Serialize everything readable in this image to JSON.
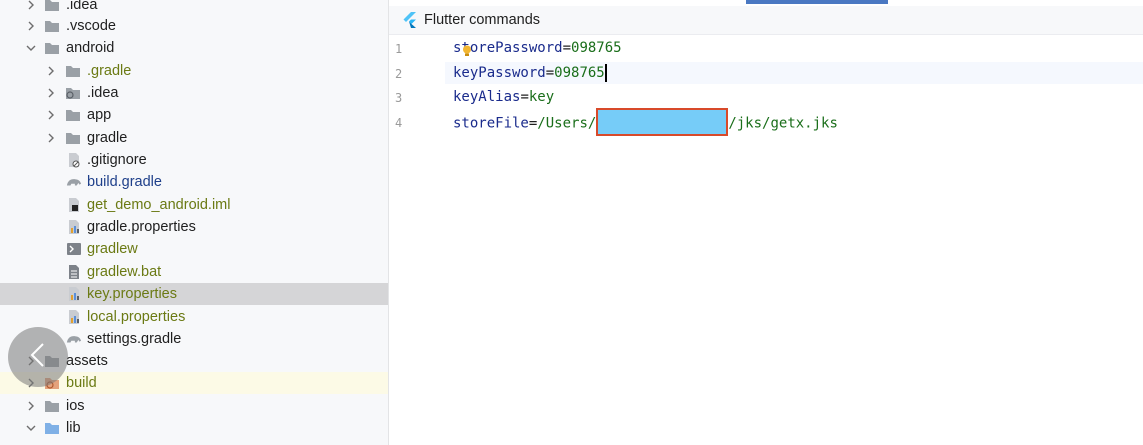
{
  "project_tree": {
    "rows": [
      {
        "label": ".idea",
        "icon": "folder-gear-icon",
        "chevron": "right",
        "color": "dark"
      },
      {
        "label": ".vscode",
        "icon": "folder-icon",
        "chevron": "right",
        "color": "dark"
      },
      {
        "label": "android",
        "icon": "folder-icon",
        "chevron": "down",
        "color": "dark"
      },
      {
        "label": ".gradle",
        "icon": "folder-icon",
        "chevron": "right",
        "color": "olive"
      },
      {
        "label": ".idea",
        "icon": "folder-gear-icon",
        "chevron": "right",
        "color": "dark"
      },
      {
        "label": "app",
        "icon": "folder-icon",
        "chevron": "right",
        "color": "dark"
      },
      {
        "label": "gradle",
        "icon": "folder-icon",
        "chevron": "right",
        "color": "dark"
      },
      {
        "label": ".gitignore",
        "icon": "gitignore-file-icon",
        "chevron": "",
        "color": "dark"
      },
      {
        "label": "build.gradle",
        "icon": "gradle-elephant-icon",
        "chevron": "",
        "color": "blue"
      },
      {
        "label": "get_demo_android.iml",
        "icon": "iml-file-icon",
        "chevron": "",
        "color": "olive"
      },
      {
        "label": "gradle.properties",
        "icon": "properties-file-icon",
        "chevron": "",
        "color": "dark"
      },
      {
        "label": "gradlew",
        "icon": "shell-script-icon",
        "chevron": "",
        "color": "olive"
      },
      {
        "label": "gradlew.bat",
        "icon": "text-file-icon",
        "chevron": "",
        "color": "olive"
      },
      {
        "label": "key.properties",
        "icon": "properties-file-icon",
        "chevron": "",
        "color": "olive"
      },
      {
        "label": "local.properties",
        "icon": "properties-file-icon",
        "chevron": "",
        "color": "olive"
      },
      {
        "label": "settings.gradle",
        "icon": "gradle-elephant-icon",
        "chevron": "",
        "color": "dark"
      },
      {
        "label": "assets",
        "icon": "folder-icon",
        "chevron": "right",
        "color": "dark"
      },
      {
        "label": "build",
        "icon": "folder-excluded-icon",
        "chevron": "right",
        "color": "olive"
      },
      {
        "label": "ios",
        "icon": "folder-icon",
        "chevron": "right",
        "color": "dark"
      },
      {
        "label": "lib",
        "icon": "folder-blue-icon",
        "chevron": "down",
        "color": "dark"
      }
    ],
    "selected_label": "key.properties"
  },
  "editor": {
    "command_bar_label": "Flutter commands",
    "lines": [
      {
        "number": "1",
        "key": "storePassword",
        "value": "098765"
      },
      {
        "number": "2",
        "key": "keyPassword",
        "value": "098765"
      },
      {
        "number": "3",
        "key": "keyAlias",
        "value": "key"
      },
      {
        "number": "4",
        "key": "storeFile",
        "value_prefix": "/Users/",
        "value_suffix": "/jks/getx.jks"
      }
    ]
  },
  "colors": {
    "selected_row": "#d5d5d7",
    "redaction_fill": "#76ccf8",
    "redaction_border": "#d84a2a",
    "accent": "#4a78c2"
  }
}
